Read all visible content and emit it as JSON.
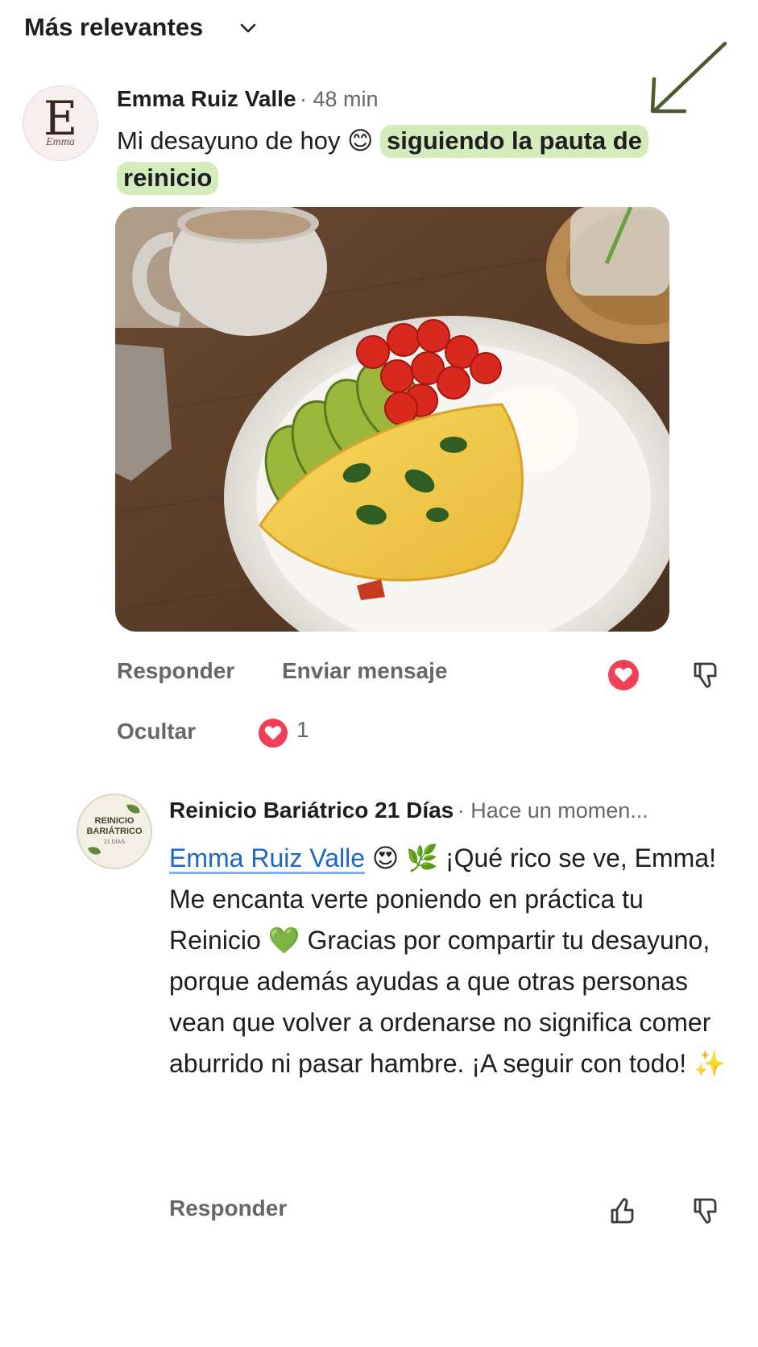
{
  "sort": {
    "label": "Más relevantes"
  },
  "comment": {
    "author": "Emma Ruiz Valle",
    "time": "48 min",
    "text_prefix": "Mi desayuno de hoy",
    "emoji": "😊",
    "highlight_text": "siguiendo la pauta de reinicio",
    "avatar": {
      "letter": "E",
      "script": "Emma"
    },
    "actions": {
      "reply": "Responder",
      "message": "Enviar mensaje",
      "hide": "Ocultar"
    },
    "like_count": "1",
    "colors": {
      "highlight": "#d4ecbc",
      "arrow": "#4a5a2e",
      "heart": "#f33e58"
    }
  },
  "reply": {
    "author": "Reinicio Bariátrico 21 Días",
    "time": "Hace un momen...",
    "mention": "Emma Ruiz Valle",
    "emoji_1": "😍",
    "emoji_2": "🌿",
    "text_1": "¡Qué rico se ve, Emma! Me encanta verte poniendo en práctica tu Reinicio",
    "emoji_3": "💚",
    "text_2": "Gracias por compartir tu desayuno, porque además ayudas a que otras personas vean que volver a ordenarse no significa comer aburrido ni pasar hambre. ¡A seguir con todo!",
    "emoji_4": "✨",
    "avatar": {
      "line1": "REINICIO",
      "line2": "BARIÁTRICO",
      "line3": "21 DÍAS"
    },
    "actions": {
      "reply": "Responder"
    },
    "colors": {
      "mention": "#1a66c9"
    }
  },
  "icons": {
    "sort": "chevron-down-icon",
    "like_filled": "heart-icon",
    "dislike": "thumbs-down-icon",
    "like": "thumbs-up-icon",
    "annotation": "arrow-annotation-icon"
  }
}
